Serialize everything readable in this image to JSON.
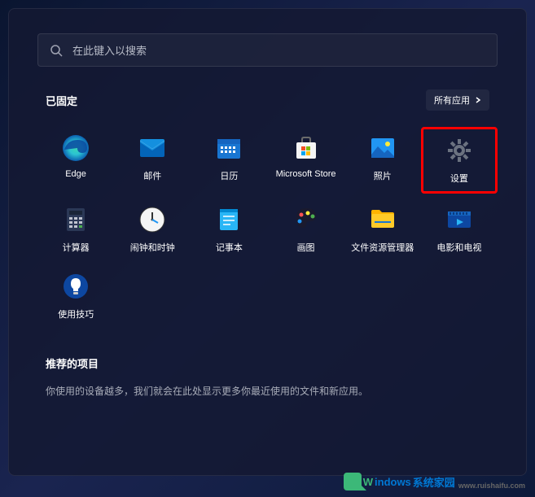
{
  "search": {
    "placeholder": "在此键入以搜索"
  },
  "pinned": {
    "title": "已固定",
    "all_apps_label": "所有应用",
    "apps": [
      {
        "name": "Edge"
      },
      {
        "name": "邮件"
      },
      {
        "name": "日历"
      },
      {
        "name": "Microsoft Store"
      },
      {
        "name": "照片"
      },
      {
        "name": "设置",
        "highlighted": true
      },
      {
        "name": "计算器"
      },
      {
        "name": "闹钟和时钟"
      },
      {
        "name": "记事本"
      },
      {
        "name": "画图"
      },
      {
        "name": "文件资源管理器"
      },
      {
        "name": "电影和电视"
      },
      {
        "name": "使用技巧"
      }
    ]
  },
  "recommended": {
    "title": "推荐的项目",
    "message": "你使用的设备越多，我们就会在此处显示更多你最近使用的文件和新应用。"
  },
  "watermark": {
    "brand_w": "W",
    "brand_rest": "indows",
    "suffix": "系统家园",
    "url": "www.ruishaifu.com"
  }
}
